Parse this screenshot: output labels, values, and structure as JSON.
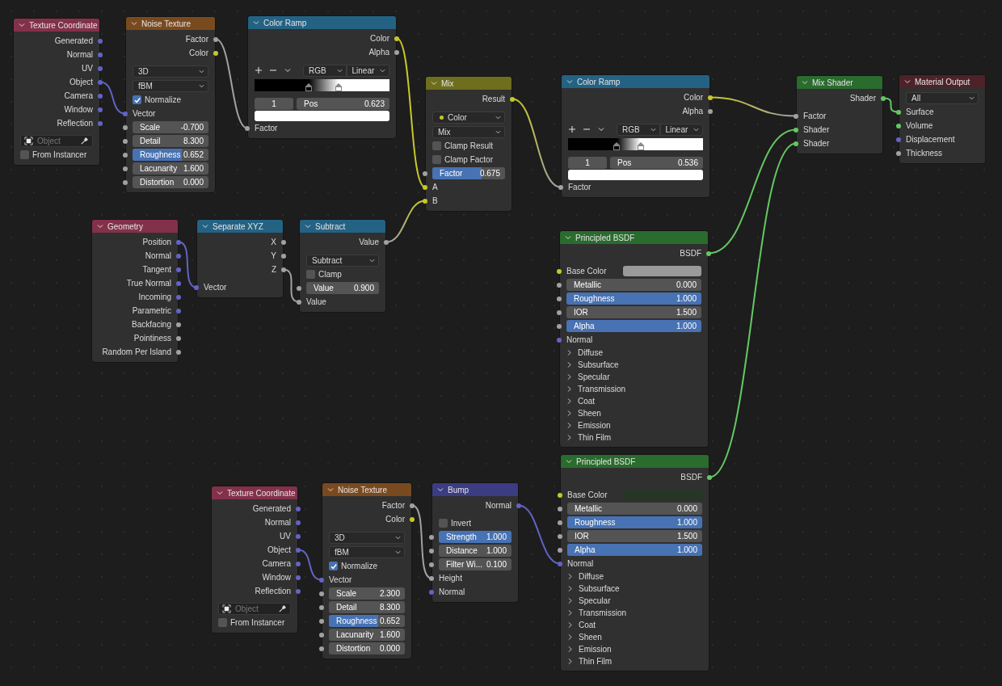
{
  "nodes": [
    {
      "title": "Texture Coordinate",
      "color": "#83314a",
      "rows": [
        {
          "kind": "output",
          "label": "Generated",
          "socket": {
            "color": "#6363c7"
          }
        },
        {
          "kind": "output",
          "label": "Normal",
          "socket": {
            "color": "#6363c7"
          }
        },
        {
          "kind": "output",
          "label": "UV",
          "socket": {
            "color": "#6363c7"
          }
        },
        {
          "kind": "output",
          "label": "Object",
          "socket": {
            "color": "#6363c7"
          }
        },
        {
          "kind": "output",
          "label": "Camera",
          "socket": {
            "color": "#6363c7"
          }
        },
        {
          "kind": "output",
          "label": "Window",
          "socket": {
            "color": "#6363c7"
          }
        },
        {
          "kind": "output",
          "label": "Reflection",
          "socket": {
            "color": "#6363c7"
          }
        },
        {
          "kind": "object",
          "placeholder": "Object"
        },
        {
          "kind": "checkbox",
          "label": "From Instancer",
          "checked": false
        }
      ]
    },
    {
      "title": "Noise Texture",
      "color": "#7a4a1f",
      "rows": [
        {
          "kind": "output",
          "label": "Factor",
          "socket": {
            "color": "#a1a1a1"
          }
        },
        {
          "kind": "output",
          "label": "Color",
          "socket": {
            "color": "#c7c729"
          }
        },
        {
          "kind": "dropdown",
          "value": "3D"
        },
        {
          "kind": "dropdown",
          "value": "fBM"
        },
        {
          "kind": "checkbox",
          "label": "Normalize",
          "checked": true
        },
        {
          "kind": "input",
          "label": "Vector",
          "socket": {
            "color": "#6363c7"
          }
        },
        {
          "kind": "number",
          "label": "Scale",
          "value": "-0.700",
          "socket": {
            "color": "#a1a1a1"
          }
        },
        {
          "kind": "number",
          "label": "Detail",
          "value": "8.300",
          "socket": {
            "color": "#a1a1a1"
          }
        },
        {
          "kind": "number",
          "label": "Roughness",
          "value": "0.652",
          "socket": {
            "color": "#a1a1a1"
          },
          "level": 0.652
        },
        {
          "kind": "number",
          "label": "Lacunarity",
          "value": "1.600",
          "socket": {
            "color": "#a1a1a1"
          }
        },
        {
          "kind": "number",
          "label": "Distortion",
          "value": "0.000",
          "socket": {
            "color": "#a1a1a1"
          }
        }
      ]
    },
    {
      "title": "Color Ramp",
      "color": "#246283",
      "rows": [
        {
          "kind": "output",
          "label": "Color",
          "socket": {
            "color": "#c7c729"
          }
        },
        {
          "kind": "output",
          "label": "Alpha",
          "socket": {
            "color": "#a1a1a1"
          }
        },
        {
          "kind": "ramp-tools",
          "mode": "RGB",
          "interpolation": "Linear"
        },
        {
          "kind": "ramp",
          "stops": [
            {
              "level": 0.4,
              "color": "#000000"
            },
            {
              "level": 0.623,
              "color": "#ffffff"
            }
          ]
        },
        {
          "kind": "ramp-stop",
          "index": "1",
          "label": "Pos",
          "value": "0.623"
        },
        {
          "kind": "swatch",
          "color": "#ffffff"
        },
        {
          "kind": "input",
          "label": "Factor",
          "socket": {
            "color": "#a1a1a1"
          }
        }
      ]
    },
    {
      "title": "Mix",
      "color": "#6e6e1d",
      "rows": [
        {
          "kind": "output",
          "label": "Result",
          "socket": {
            "color": "#c7c729"
          }
        },
        {
          "kind": "dropdown",
          "value": "Color",
          "dot": {
            "color": "#c7c729"
          }
        },
        {
          "kind": "dropdown",
          "value": "Mix"
        },
        {
          "kind": "checkbox",
          "label": "Clamp Result",
          "checked": false
        },
        {
          "kind": "checkbox",
          "label": "Clamp Factor",
          "checked": false
        },
        {
          "kind": "number",
          "label": "Factor",
          "value": "0.675",
          "socket": {
            "color": "#a1a1a1"
          },
          "level": 0.675
        },
        {
          "kind": "input",
          "label": "A",
          "socket": {
            "color": "#c7c729"
          }
        },
        {
          "kind": "input",
          "label": "B",
          "socket": {
            "color": "#c7c729"
          }
        }
      ]
    },
    {
      "title": "Color Ramp",
      "color": "#246283",
      "rows": [
        {
          "kind": "output",
          "label": "Color",
          "socket": {
            "color": "#c7c729"
          }
        },
        {
          "kind": "output",
          "label": "Alpha",
          "socket": {
            "color": "#a1a1a1"
          }
        },
        {
          "kind": "ramp-tools",
          "mode": "RGB",
          "interpolation": "Linear"
        },
        {
          "kind": "ramp",
          "stops": [
            {
              "level": 0.36,
              "color": "#000000"
            },
            {
              "level": 0.536,
              "color": "#ffffff"
            }
          ]
        },
        {
          "kind": "ramp-stop",
          "index": "1",
          "label": "Pos",
          "value": "0.536"
        },
        {
          "kind": "swatch",
          "color": "#ffffff"
        },
        {
          "kind": "input",
          "label": "Factor",
          "socket": {
            "color": "#a1a1a1"
          }
        }
      ]
    },
    {
      "title": "Mix Shader",
      "color": "#2a6b2e",
      "rows": [
        {
          "kind": "output",
          "label": "Shader",
          "socket": {
            "color": "#63c763"
          }
        },
        {
          "kind": "input",
          "label": "Factor",
          "socket": {
            "color": "#a1a1a1"
          }
        },
        {
          "kind": "input",
          "label": "Shader",
          "socket": {
            "color": "#63c763"
          }
        },
        {
          "kind": "input",
          "label": "Shader",
          "socket": {
            "color": "#63c763"
          }
        }
      ]
    },
    {
      "title": "Material Output",
      "color": "#4e2229",
      "rows": [
        {
          "kind": "dropdown",
          "value": "All"
        },
        {
          "kind": "input",
          "label": "Surface",
          "socket": {
            "color": "#63c763"
          }
        },
        {
          "kind": "input",
          "label": "Volume",
          "socket": {
            "color": "#63c763"
          }
        },
        {
          "kind": "input",
          "label": "Displacement",
          "socket": {
            "color": "#6363c7"
          }
        },
        {
          "kind": "input",
          "label": "Thickness",
          "socket": {
            "color": "#a1a1a1"
          }
        }
      ]
    },
    {
      "title": "Geometry",
      "color": "#83314a",
      "rows": [
        {
          "kind": "output",
          "label": "Position",
          "socket": {
            "color": "#6363c7"
          }
        },
        {
          "kind": "output",
          "label": "Normal",
          "socket": {
            "color": "#6363c7"
          }
        },
        {
          "kind": "output",
          "label": "Tangent",
          "socket": {
            "color": "#6363c7"
          }
        },
        {
          "kind": "output",
          "label": "True Normal",
          "socket": {
            "color": "#6363c7"
          }
        },
        {
          "kind": "output",
          "label": "Incoming",
          "socket": {
            "color": "#6363c7"
          }
        },
        {
          "kind": "output",
          "label": "Parametric",
          "socket": {
            "color": "#6363c7"
          }
        },
        {
          "kind": "output",
          "label": "Backfacing",
          "socket": {
            "color": "#a1a1a1"
          }
        },
        {
          "kind": "output",
          "label": "Pointiness",
          "socket": {
            "color": "#a1a1a1"
          }
        },
        {
          "kind": "output",
          "label": "Random Per Island",
          "socket": {
            "color": "#a1a1a1"
          }
        }
      ]
    },
    {
      "title": "Separate XYZ",
      "color": "#246283",
      "rows": [
        {
          "kind": "output",
          "label": "X",
          "socket": {
            "color": "#a1a1a1"
          }
        },
        {
          "kind": "output",
          "label": "Y",
          "socket": {
            "color": "#a1a1a1"
          }
        },
        {
          "kind": "output",
          "label": "Z",
          "socket": {
            "color": "#a1a1a1"
          }
        },
        {
          "kind": "input",
          "label": "Vector",
          "socket": {
            "color": "#6363c7"
          }
        }
      ]
    },
    {
      "title": "Subtract",
      "color": "#246283",
      "rows": [
        {
          "kind": "output",
          "label": "Value",
          "socket": {
            "color": "#a1a1a1"
          }
        },
        {
          "kind": "dropdown",
          "value": "Subtract"
        },
        {
          "kind": "checkbox",
          "label": "Clamp",
          "checked": false
        },
        {
          "kind": "number",
          "label": "Value",
          "value": "0.900",
          "socket": {
            "color": "#a1a1a1"
          }
        },
        {
          "kind": "input",
          "label": "Value",
          "socket": {
            "color": "#a1a1a1"
          }
        }
      ]
    },
    {
      "title": "Principled BSDF",
      "color": "#2a6b2e",
      "rows": [
        {
          "kind": "output",
          "label": "BSDF",
          "socket": {
            "color": "#63c763"
          }
        },
        {
          "kind": "color-input",
          "label": "Base Color",
          "socket": {
            "color": "#c7c729"
          },
          "color": "#9a9a9a"
        },
        {
          "kind": "number",
          "label": "Metallic",
          "value": "0.000",
          "socket": {
            "color": "#a1a1a1"
          }
        },
        {
          "kind": "number",
          "label": "Roughness",
          "value": "1.000",
          "socket": {
            "color": "#a1a1a1"
          },
          "level": 1
        },
        {
          "kind": "number",
          "label": "IOR",
          "value": "1.500",
          "socket": {
            "color": "#a1a1a1"
          }
        },
        {
          "kind": "number",
          "label": "Alpha",
          "value": "1.000",
          "socket": {
            "color": "#a1a1a1"
          },
          "level": 1
        },
        {
          "kind": "input",
          "label": "Normal",
          "socket": {
            "color": "#6363c7"
          }
        },
        {
          "kind": "panel",
          "label": "Diffuse",
          "expanded": false
        },
        {
          "kind": "panel",
          "label": "Subsurface",
          "expanded": false
        },
        {
          "kind": "panel",
          "label": "Specular",
          "expanded": false
        },
        {
          "kind": "panel",
          "label": "Transmission",
          "expanded": false
        },
        {
          "kind": "panel",
          "label": "Coat",
          "expanded": false
        },
        {
          "kind": "panel",
          "label": "Sheen",
          "expanded": false
        },
        {
          "kind": "panel",
          "label": "Emission",
          "expanded": false
        },
        {
          "kind": "panel",
          "label": "Thin Film",
          "expanded": false
        }
      ]
    },
    {
      "title": "Texture Coordinate",
      "color": "#83314a",
      "rows": [
        {
          "kind": "output",
          "label": "Generated",
          "socket": {
            "color": "#6363c7"
          }
        },
        {
          "kind": "output",
          "label": "Normal",
          "socket": {
            "color": "#6363c7"
          }
        },
        {
          "kind": "output",
          "label": "UV",
          "socket": {
            "color": "#6363c7"
          }
        },
        {
          "kind": "output",
          "label": "Object",
          "socket": {
            "color": "#6363c7"
          }
        },
        {
          "kind": "output",
          "label": "Camera",
          "socket": {
            "color": "#6363c7"
          }
        },
        {
          "kind": "output",
          "label": "Window",
          "socket": {
            "color": "#6363c7"
          }
        },
        {
          "kind": "output",
          "label": "Reflection",
          "socket": {
            "color": "#6363c7"
          }
        },
        {
          "kind": "object",
          "placeholder": "Object"
        },
        {
          "kind": "checkbox",
          "label": "From Instancer",
          "checked": false
        }
      ]
    },
    {
      "title": "Noise Texture",
      "color": "#7a4a1f",
      "rows": [
        {
          "kind": "output",
          "label": "Factor",
          "socket": {
            "color": "#a1a1a1"
          }
        },
        {
          "kind": "output",
          "label": "Color",
          "socket": {
            "color": "#c7c729"
          }
        },
        {
          "kind": "dropdown",
          "value": "3D"
        },
        {
          "kind": "dropdown",
          "value": "fBM"
        },
        {
          "kind": "checkbox",
          "label": "Normalize",
          "checked": true
        },
        {
          "kind": "input",
          "label": "Vector",
          "socket": {
            "color": "#6363c7"
          }
        },
        {
          "kind": "number",
          "label": "Scale",
          "value": "2.300",
          "socket": {
            "color": "#a1a1a1"
          }
        },
        {
          "kind": "number",
          "label": "Detail",
          "value": "8.300",
          "socket": {
            "color": "#a1a1a1"
          }
        },
        {
          "kind": "number",
          "label": "Roughness",
          "value": "0.652",
          "socket": {
            "color": "#a1a1a1"
          },
          "level": 0.652
        },
        {
          "kind": "number",
          "label": "Lacunarity",
          "value": "1.600",
          "socket": {
            "color": "#a1a1a1"
          }
        },
        {
          "kind": "number",
          "label": "Distortion",
          "value": "0.000",
          "socket": {
            "color": "#a1a1a1"
          }
        }
      ]
    },
    {
      "title": "Bump",
      "color": "#3c3c83",
      "rows": [
        {
          "kind": "output",
          "label": "Normal",
          "socket": {
            "color": "#6363c7"
          }
        },
        {
          "kind": "checkbox",
          "label": "Invert",
          "checked": false
        },
        {
          "kind": "number",
          "label": "Strength",
          "value": "1.000",
          "socket": {
            "color": "#a1a1a1"
          },
          "level": 1
        },
        {
          "kind": "number",
          "label": "Distance",
          "value": "1.000",
          "socket": {
            "color": "#a1a1a1"
          }
        },
        {
          "kind": "number",
          "label": "Filter Wi...",
          "value": "0.100",
          "socket": {
            "color": "#a1a1a1"
          }
        },
        {
          "kind": "input",
          "label": "Height",
          "socket": {
            "color": "#a1a1a1"
          }
        },
        {
          "kind": "input",
          "label": "Normal",
          "socket": {
            "color": "#6363c7"
          }
        }
      ]
    },
    {
      "title": "Principled BSDF",
      "color": "#2a6b2e",
      "rows": [
        {
          "kind": "output",
          "label": "BSDF",
          "socket": {
            "color": "#63c763"
          }
        },
        {
          "kind": "color-input",
          "label": "Base Color",
          "socket": {
            "color": "#c7c729"
          },
          "color": "#263626"
        },
        {
          "kind": "number",
          "label": "Metallic",
          "value": "0.000",
          "socket": {
            "color": "#a1a1a1"
          }
        },
        {
          "kind": "number",
          "label": "Roughness",
          "value": "1.000",
          "socket": {
            "color": "#a1a1a1"
          },
          "level": 1
        },
        {
          "kind": "number",
          "label": "IOR",
          "value": "1.500",
          "socket": {
            "color": "#a1a1a1"
          }
        },
        {
          "kind": "number",
          "label": "Alpha",
          "value": "1.000",
          "socket": {
            "color": "#a1a1a1"
          },
          "level": 1
        },
        {
          "kind": "input",
          "label": "Normal",
          "socket": {
            "color": "#6363c7"
          }
        },
        {
          "kind": "panel",
          "label": "Diffuse",
          "expanded": false
        },
        {
          "kind": "panel",
          "label": "Subsurface",
          "expanded": false
        },
        {
          "kind": "panel",
          "label": "Specular",
          "expanded": false
        },
        {
          "kind": "panel",
          "label": "Transmission",
          "expanded": false
        },
        {
          "kind": "panel",
          "label": "Coat",
          "expanded": false
        },
        {
          "kind": "panel",
          "label": "Sheen",
          "expanded": false
        },
        {
          "kind": "panel",
          "label": "Emission",
          "expanded": false
        },
        {
          "kind": "panel",
          "label": "Thin Film",
          "expanded": false
        }
      ]
    }
  ]
}
